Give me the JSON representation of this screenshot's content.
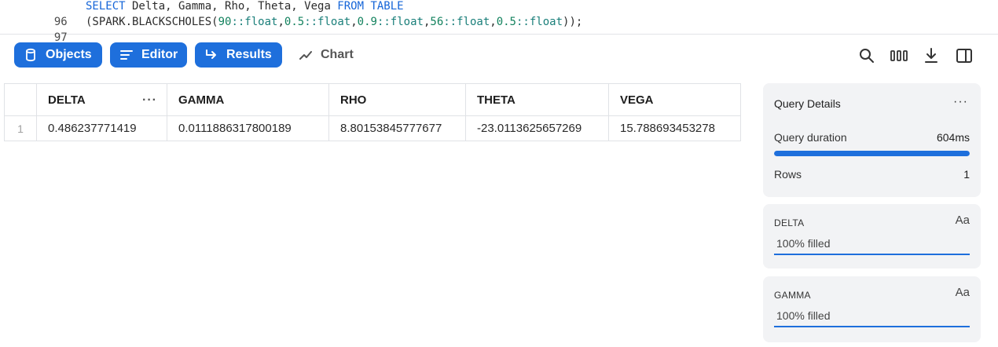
{
  "editor": {
    "lines": [
      {
        "number": "96",
        "keyword1": "SELECT",
        "middle": " Delta, Gamma, Rho, Theta, Vega ",
        "keyword2": "FROM TABLE"
      },
      {
        "number": "97",
        "prefix": "(SPARK.BLACKSCHOLES(",
        "a1": "90",
        "t1": "::float",
        "c1": ",",
        "a2": "0.5",
        "t2": "::float",
        "c2": ",",
        "a3": "0.9",
        "t3": "::float",
        "c3": ",",
        "a4": "56",
        "t4": "::float",
        "c4": ",",
        "a5": "0.5",
        "t5": "::float",
        "suffix": "));"
      }
    ]
  },
  "toolbar": {
    "objects_label": "Objects",
    "editor_label": "Editor",
    "results_label": "Results",
    "chart_label": "Chart",
    "accent": "#1e6fdc"
  },
  "results": {
    "columns": [
      "DELTA",
      "GAMMA",
      "RHO",
      "THETA",
      "VEGA"
    ],
    "rows": [
      {
        "row_number": "1",
        "cells": [
          "0.486237771419",
          "0.0111886317800189",
          "8.80153845777677",
          "-23.0113625657269",
          "15.788693453278"
        ]
      }
    ]
  },
  "query_details": {
    "title": "Query Details",
    "duration_label": "Query duration",
    "duration_value": "604ms",
    "rows_label": "Rows",
    "rows_value": "1"
  },
  "column_cards": [
    {
      "name": "DELTA",
      "type_icon": "Aa",
      "filled_text": "100% filled"
    },
    {
      "name": "GAMMA",
      "type_icon": "Aa",
      "filled_text": "100% filled"
    }
  ]
}
